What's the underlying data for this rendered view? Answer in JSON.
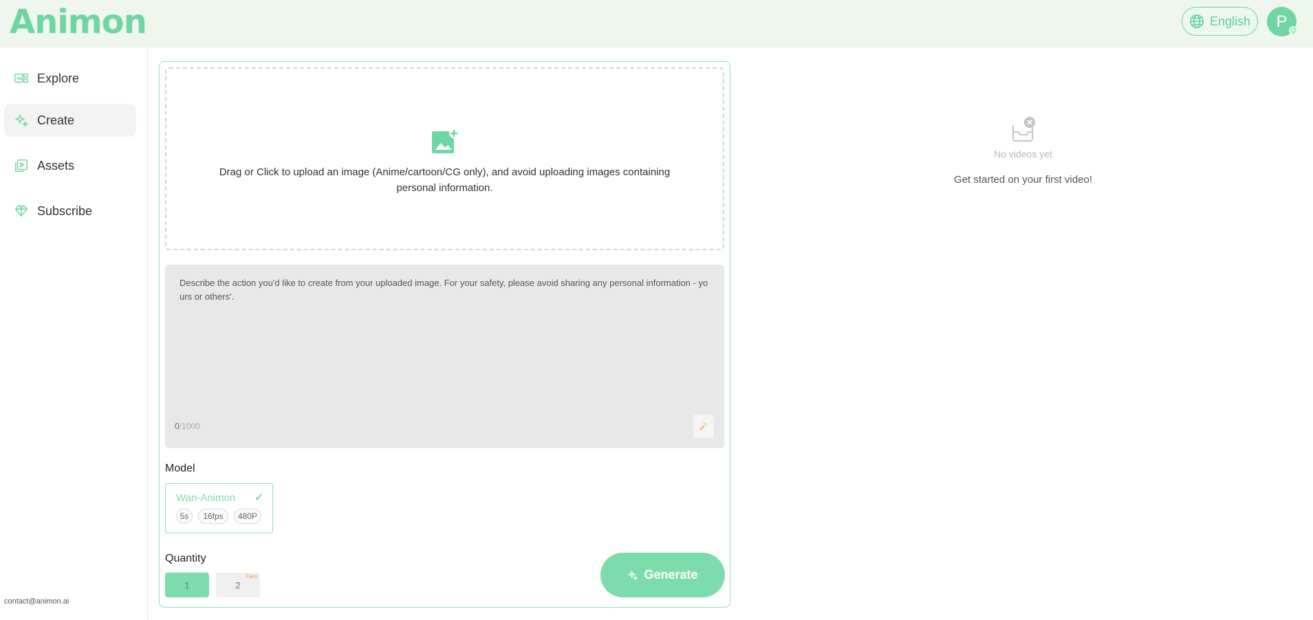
{
  "header": {
    "logo": "Animon",
    "language": "English",
    "avatar_initial": "P"
  },
  "sidebar": {
    "items": [
      {
        "label": "Explore",
        "icon": "explore-icon"
      },
      {
        "label": "Create",
        "icon": "sparkle-icon",
        "active": true
      },
      {
        "label": "Assets",
        "icon": "assets-icon"
      },
      {
        "label": "Subscribe",
        "icon": "diamond-icon"
      }
    ],
    "contact": "contact@animon.ai"
  },
  "upload": {
    "text": "Drag or Click to upload an image (Anime/cartoon/CG only), and avoid uploading images containing personal information."
  },
  "prompt": {
    "placeholder": "Describe the action you'd like to create from your uploaded image. For your safety, please avoid sharing any personal information - yours or others'.",
    "count": "0",
    "max": "/1000"
  },
  "model": {
    "label": "Model",
    "name": "Wan-Animon",
    "check": "✓",
    "tags": [
      "5s",
      "16fps",
      "480P"
    ]
  },
  "quantity": {
    "label": "Quantity",
    "options": [
      "1",
      "2"
    ],
    "badge": "Fans"
  },
  "generate": {
    "label": "Generate"
  },
  "empty_state": {
    "title": "No videos yet",
    "subtitle": "Get started on your first video!"
  },
  "colors": {
    "accent": "#6fd6a3",
    "header_bg": "#eef6ee",
    "prompt_bg": "#e8e8e8"
  }
}
